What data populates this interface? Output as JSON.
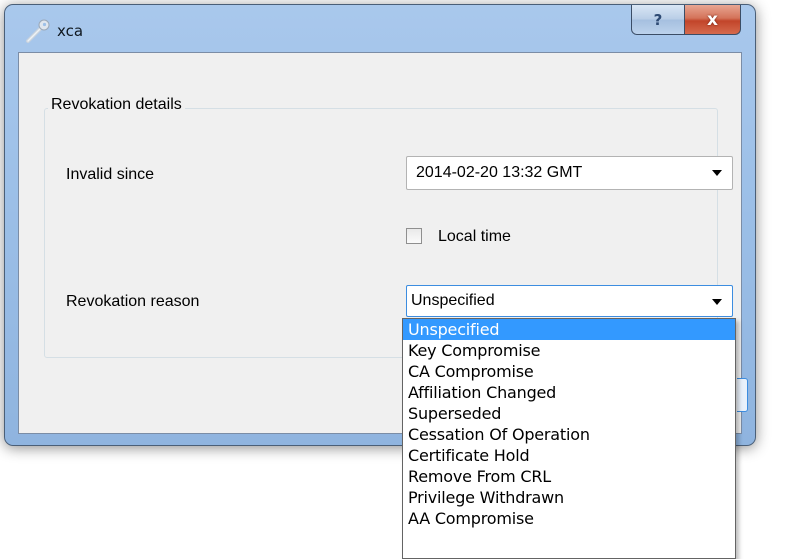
{
  "window": {
    "title": "xca",
    "help_label": "?",
    "close_label": "x"
  },
  "group": {
    "title": "Revokation details"
  },
  "invalid_since": {
    "label": "Invalid since",
    "value": "2014-02-20 13:32 GMT"
  },
  "local_time": {
    "label": "Local time",
    "checked": false
  },
  "revocation_reason": {
    "label": "Revokation reason",
    "value": "Unspecified",
    "options": [
      "Unspecified",
      "Key Compromise",
      "CA Compromise",
      "Affiliation Changed",
      "Superseded",
      "Cessation Of Operation",
      "Certificate Hold",
      "Remove From CRL",
      "Privilege Withdrawn",
      "AA Compromise"
    ],
    "selected_index": 0
  },
  "colors": {
    "selection": "#3399ff",
    "focus_border": "#3c8de0",
    "close_button": "#c2452a"
  },
  "icons": {
    "app": "key-icon",
    "dropdown": "chevron-down-icon"
  }
}
